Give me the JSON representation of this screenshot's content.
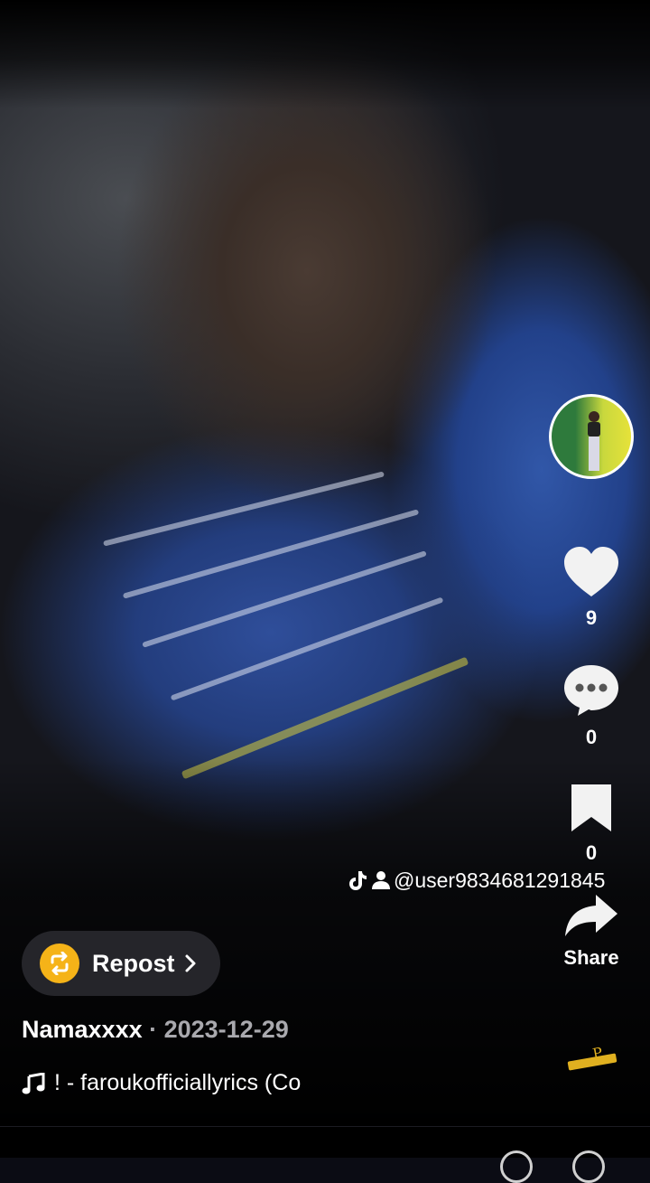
{
  "video": {
    "stats": {
      "likes": "9",
      "comments": "0",
      "saves": "0",
      "share_label": "Share"
    },
    "attribution": {
      "handle": "@user9834681291845"
    }
  },
  "repost": {
    "label": "Repost"
  },
  "author": {
    "name": "Namaxxxx",
    "separator": " · ",
    "date": "2023-12-29"
  },
  "music": {
    "title": "! - faroukofficiallyrics (Co"
  },
  "colors": {
    "accent": "#f5b318",
    "muted_text": "#a9a9ae",
    "pill_bg": "#28282e"
  },
  "icons": [
    "heart-icon",
    "comment-icon",
    "bookmark-icon",
    "share-arrow-icon",
    "repost-icon",
    "chevron-right-icon",
    "music-note-icon",
    "tiktok-logo-icon",
    "person-icon"
  ]
}
